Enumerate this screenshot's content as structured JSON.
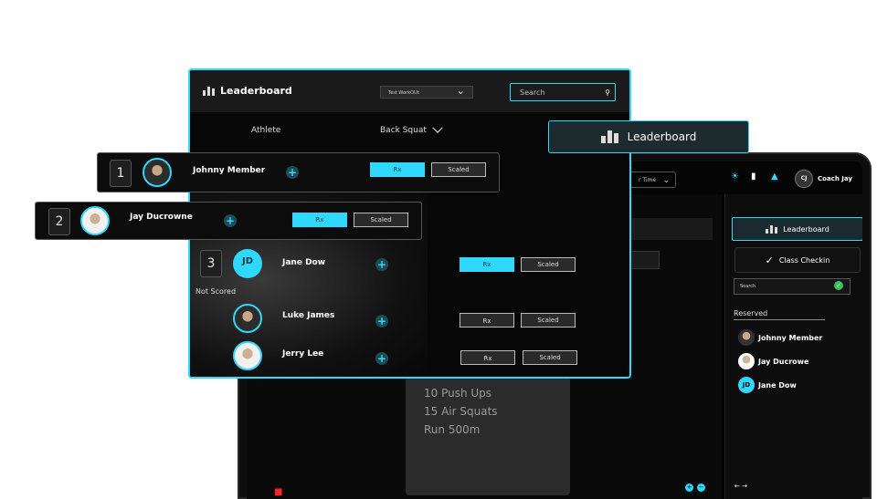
{
  "leaderboard": {
    "title": "Leaderboard",
    "workout_select": "Test WorkOUt",
    "search_placeholder": "Search",
    "col_athlete": "Athlete",
    "col_movement": "Back Squat",
    "rx_label": "Rx",
    "scaled_label": "Scaled",
    "not_scored_label": "Not Scored",
    "ranked": [
      {
        "rank": "1",
        "name": "Johnny Member",
        "rx_active": true
      },
      {
        "rank": "2",
        "name": "Jay Ducrowne",
        "rx_active": true
      },
      {
        "rank": "3",
        "name": "Jane Dow",
        "initials": "JD",
        "rx_active": true
      }
    ],
    "unscored": [
      {
        "name": "Luke James"
      },
      {
        "name": "Jerry Lee"
      }
    ]
  },
  "floating_chip": {
    "label": "Leaderboard"
  },
  "laptop": {
    "time_select": "r Time",
    "coach": {
      "initials": "CJ",
      "name": "Coach Jay"
    },
    "sidebar": {
      "leaderboard_label": "Leaderboard",
      "checkin_label": "Class Checkin",
      "search_placeholder": "Search",
      "reserved_label": "Reserved",
      "reserved": [
        {
          "name": "Johnny Member"
        },
        {
          "name": "Jay Ducrowe"
        },
        {
          "name": "Jane Dow",
          "initials": "JD"
        }
      ]
    },
    "workout": [
      "10 Push Ups",
      "15 Air Squats",
      "Run 500m"
    ]
  },
  "colors": {
    "accent": "#2fd8ff",
    "background": "#000000",
    "success": "#36c35a"
  }
}
